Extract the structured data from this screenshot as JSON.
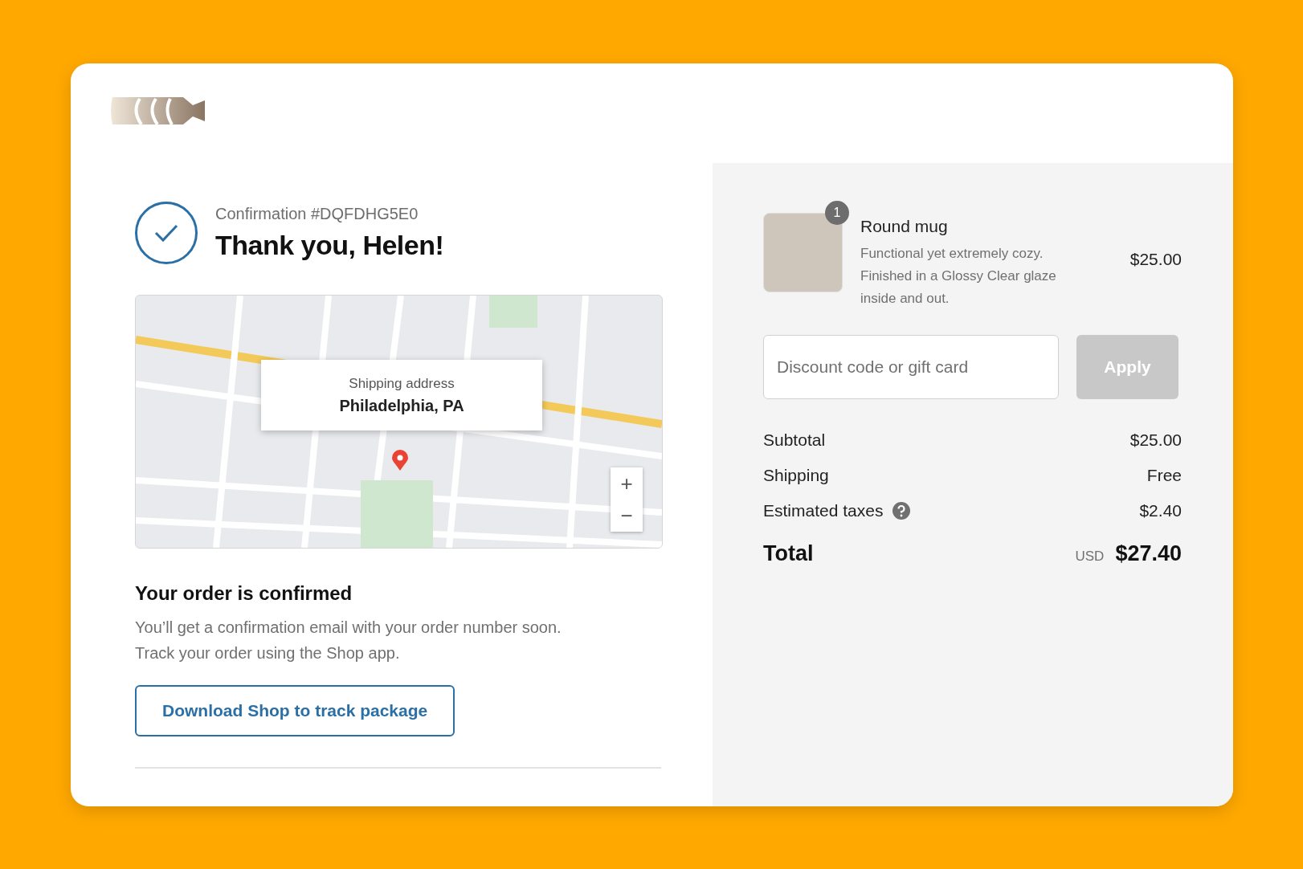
{
  "confirmation": {
    "number": "Confirmation #DQFDHG5E0",
    "title": "Thank you, Helen!"
  },
  "map": {
    "popup_label": "Shipping address",
    "popup_value": "Philadelphia, PA",
    "zoom_in": "+",
    "zoom_out": "−"
  },
  "order_status": {
    "heading": "Your order is confirmed",
    "message": "You’ll get a confirmation email with your order number soon. Track your order using the Shop app."
  },
  "track_button": "Download Shop to track package",
  "cart_items": [
    {
      "name": "Round mug",
      "description": "Functional yet extremely cozy. Finished in a Glossy Clear glaze inside and out.",
      "quantity": "1",
      "price": "$25.00"
    }
  ],
  "discount": {
    "placeholder": "Discount code or gift card",
    "button": "Apply",
    "disabled": true
  },
  "summary": [
    {
      "kind": "plain",
      "label": "Subtotal",
      "value": "$25.00"
    },
    {
      "kind": "plain",
      "label": "Shipping",
      "value": "Free"
    },
    {
      "kind": "help",
      "label": "Estimated taxes",
      "value": "$2.40"
    }
  ],
  "total": {
    "label": "Total",
    "currency": "USD",
    "value": "$27.40"
  }
}
